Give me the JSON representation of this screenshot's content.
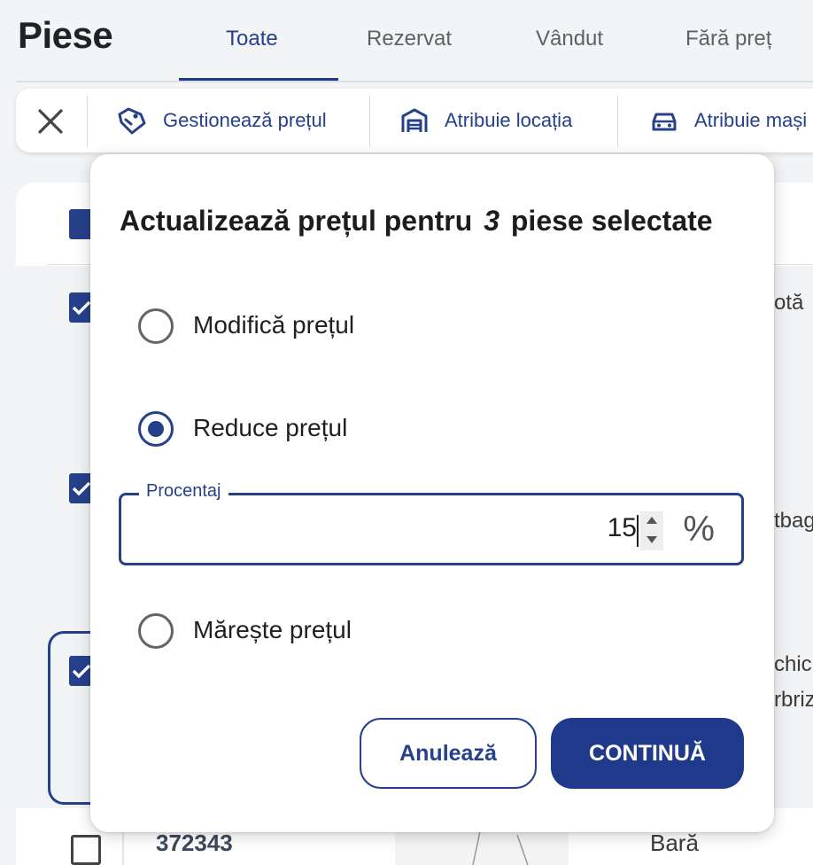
{
  "header": {
    "title": "Piese",
    "tabs": [
      {
        "label": "Toate",
        "active": true
      },
      {
        "label": "Rezervat",
        "active": false
      },
      {
        "label": "Vândut",
        "active": false
      },
      {
        "label": "Fără preț",
        "active": false
      }
    ]
  },
  "toolbar": {
    "close_icon": "close-icon",
    "items": [
      {
        "label": "Gestionează prețul",
        "icon": "price-tag-icon"
      },
      {
        "label": "Atribuie locația",
        "icon": "garage-icon"
      },
      {
        "label": "Atribuie mași",
        "icon": "car-icon"
      }
    ]
  },
  "table": {
    "rows": [
      {
        "checked": true,
        "text_fragment": "otă"
      },
      {
        "checked": true,
        "text_fragment": "tbag"
      },
      {
        "checked": true,
        "text_fragment_1": "chic",
        "text_fragment_2": "rbriz"
      },
      {
        "checked": false,
        "id": "372343",
        "name": "Bară"
      }
    ]
  },
  "dialog": {
    "title_prefix": "Actualizează prețul pentru",
    "count": "3",
    "title_suffix": "piese selectate",
    "options": [
      {
        "label": "Modifică prețul",
        "selected": false
      },
      {
        "label": "Reduce prețul",
        "selected": true
      },
      {
        "label": "Mărește prețul",
        "selected": false
      }
    ],
    "field": {
      "label": "Procentaj",
      "value": "15",
      "unit": "%"
    },
    "cancel_label": "Anulează",
    "continue_label": "CONTINUĂ"
  },
  "colors": {
    "accent": "#26408a",
    "primary_button": "#1f3a8a"
  }
}
